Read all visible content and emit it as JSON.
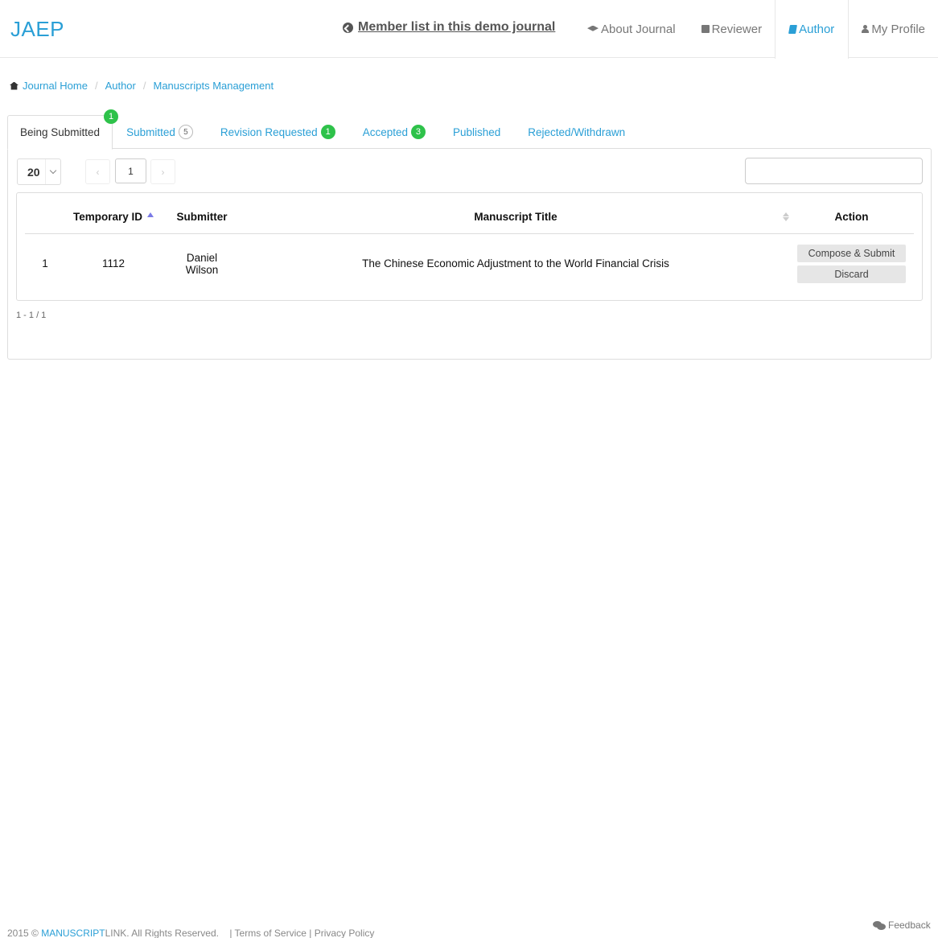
{
  "brand": "JAEP",
  "nav": {
    "member_link": "Member list in this demo journal",
    "items": [
      {
        "label": "About Journal",
        "icon": "graduation-cap-icon"
      },
      {
        "label": "Reviewer",
        "icon": "edit-icon"
      },
      {
        "label": "Author",
        "icon": "book-icon",
        "active": true
      },
      {
        "label": "My Profile",
        "icon": "user-icon"
      }
    ]
  },
  "breadcrumb": [
    "Journal Home",
    "Author",
    "Manuscripts Management"
  ],
  "tabs": [
    {
      "label": "Being Submitted",
      "badge": "1",
      "active": true
    },
    {
      "label": "Submitted",
      "badge": "5"
    },
    {
      "label": "Revision Requested",
      "badge": "1"
    },
    {
      "label": "Accepted",
      "badge": "3"
    },
    {
      "label": "Published"
    },
    {
      "label": "Rejected/Withdrawn"
    }
  ],
  "pager": {
    "page_size": "20",
    "prev": "‹",
    "current_page": "1",
    "next": "›",
    "range": "1 - 1 / 1"
  },
  "search": {
    "value": "",
    "placeholder": ""
  },
  "table": {
    "headers": [
      "",
      "Temporary ID",
      "Submitter",
      "Manuscript Title",
      "Action"
    ],
    "rows": [
      {
        "index": "1",
        "temp_id": "1112",
        "submitter_first": "Daniel",
        "submitter_last": "Wilson",
        "title": "The Chinese Economic Adjustment to the World Financial Crisis",
        "actions": [
          "Compose & Submit",
          "Discard"
        ]
      }
    ]
  },
  "footer": {
    "prefix": "2015 © ",
    "brand_a": "MANUSCRIPT",
    "brand_b": "LINK",
    "suffix": ". All Rights Reserved.",
    "links": "| Terms of Service | Privacy Policy",
    "feedback": "Feedback"
  },
  "colors": {
    "accent": "#2a9fd6",
    "badge_green": "#2ec24a",
    "sort_active": "#7a7ae6"
  }
}
